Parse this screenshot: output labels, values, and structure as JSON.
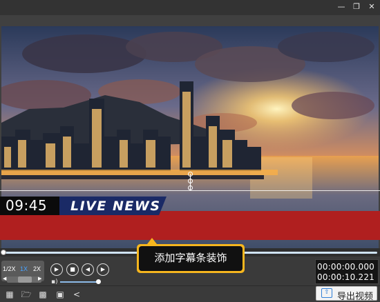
{
  "window": {
    "minimize_icon": "minimize-icon",
    "maximize_icon": "restore-icon",
    "close_icon": "close-icon"
  },
  "preview": {
    "clock": "09:45",
    "news_tag": "LIVE NEWS",
    "accent_red": "#b01f1f",
    "accent_navy": "#1a2a66"
  },
  "playback": {
    "speeds": [
      "1/2X",
      "1X",
      "2X"
    ],
    "active_speed": "1X",
    "current_time": "00:00:00.000",
    "total_time": "00:00:10.221",
    "progress": 0,
    "volume": 1
  },
  "tooltip": {
    "text": "添加字幕条装饰",
    "color": "#f6b61e"
  },
  "toolbar": {
    "icons": [
      "new-project-icon",
      "open-folder-icon",
      "save-icon",
      "save-as-icon",
      "share-icon"
    ],
    "export_label": "导出视频"
  }
}
